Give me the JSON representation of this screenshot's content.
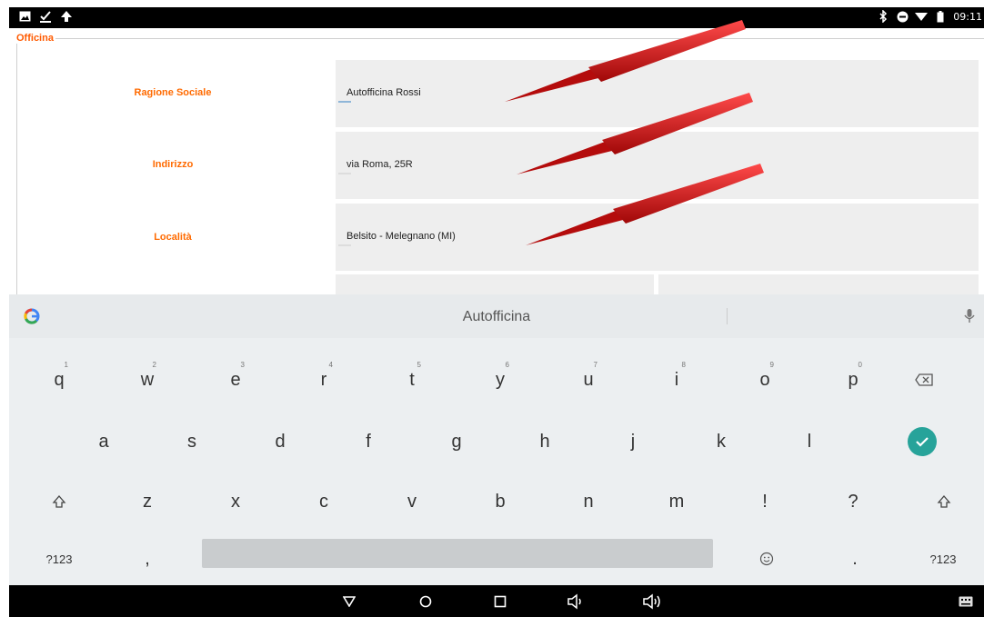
{
  "status_bar": {
    "left_icons": [
      "image-icon",
      "download-done-icon",
      "upload-icon"
    ],
    "right_icons": [
      "bluetooth-icon",
      "do-not-disturb-icon",
      "wifi-icon",
      "battery-icon"
    ],
    "time": "09:11"
  },
  "app": {
    "group_title": "Officina",
    "rows": [
      {
        "label": "Ragione Sociale",
        "value": "Autofficina Rossi"
      },
      {
        "label": "Indirizzo",
        "value": "via Roma, 25R"
      },
      {
        "label": "Località",
        "value": "Belsito - Melegnano (MI)"
      }
    ]
  },
  "colors": {
    "label": "#ff6a00",
    "field_bg": "#eeeeee",
    "arrow": "#d01414",
    "enter": "#27a39a"
  },
  "keyboard": {
    "suggestion": "Autofficina",
    "row1": [
      {
        "k": "q",
        "h": "1"
      },
      {
        "k": "w",
        "h": "2"
      },
      {
        "k": "e",
        "h": "3"
      },
      {
        "k": "r",
        "h": "4"
      },
      {
        "k": "t",
        "h": "5"
      },
      {
        "k": "y",
        "h": "6"
      },
      {
        "k": "u",
        "h": "7"
      },
      {
        "k": "i",
        "h": "8"
      },
      {
        "k": "o",
        "h": "9"
      },
      {
        "k": "p",
        "h": "0"
      }
    ],
    "row2": [
      "a",
      "s",
      "d",
      "f",
      "g",
      "h",
      "j",
      "k",
      "l"
    ],
    "row3": [
      "z",
      "x",
      "c",
      "v",
      "b",
      "n",
      "m",
      "!",
      "?"
    ],
    "symbols_label": "?123",
    "comma": ",",
    "period": "."
  },
  "nav_bar": {
    "icons": [
      "back-icon",
      "home-icon",
      "recents-icon",
      "volume-down-icon",
      "volume-up-icon",
      "keyboard-icon"
    ]
  }
}
